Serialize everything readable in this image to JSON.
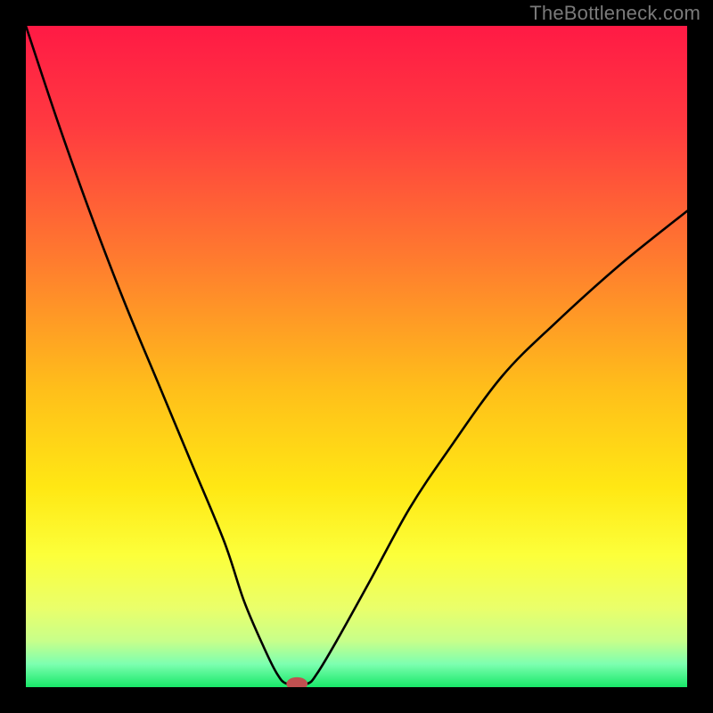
{
  "watermark": "TheBottleneck.com",
  "chart_data": {
    "type": "line",
    "title": "",
    "xlabel": "",
    "ylabel": "",
    "xlim": [
      0,
      100
    ],
    "ylim": [
      0,
      100
    ],
    "legend": false,
    "grid": false,
    "background_gradient": {
      "stops": [
        {
          "pos": 0.0,
          "color": "#ff1a45"
        },
        {
          "pos": 0.15,
          "color": "#ff3a40"
        },
        {
          "pos": 0.35,
          "color": "#ff7a2f"
        },
        {
          "pos": 0.55,
          "color": "#ffbf1a"
        },
        {
          "pos": 0.7,
          "color": "#ffe814"
        },
        {
          "pos": 0.8,
          "color": "#fcff3a"
        },
        {
          "pos": 0.88,
          "color": "#eaff6a"
        },
        {
          "pos": 0.93,
          "color": "#c8ff8a"
        },
        {
          "pos": 0.965,
          "color": "#7dffb0"
        },
        {
          "pos": 1.0,
          "color": "#18e869"
        }
      ]
    },
    "series": [
      {
        "name": "bottleneck-curve",
        "color": "#000000",
        "x": [
          0,
          5,
          10,
          15,
          20,
          25,
          30,
          33,
          36,
          38,
          39.5,
          42.5,
          44,
          47,
          52,
          58,
          64,
          72,
          80,
          90,
          100
        ],
        "y": [
          100,
          85,
          71,
          58,
          46,
          34,
          22,
          13,
          6,
          2,
          0.5,
          0.5,
          2,
          7,
          16,
          27,
          36,
          47,
          55,
          64,
          72
        ]
      }
    ],
    "markers": [
      {
        "name": "optimal-point",
        "x": 41,
        "y": 0.5,
        "color": "#c05050",
        "rx": 1.6,
        "ry": 1.0
      }
    ]
  }
}
